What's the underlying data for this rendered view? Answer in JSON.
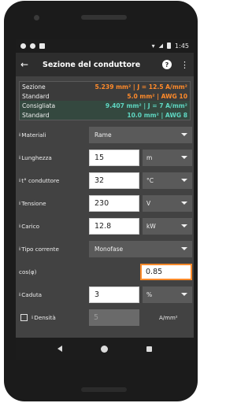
{
  "statusbar": {
    "time": "1:45"
  },
  "appbar": {
    "title": "Sezione del conduttore",
    "help_glyph": "?",
    "menu_glyph": "⋮",
    "back_glyph": "←"
  },
  "results": [
    {
      "label": "Sezione",
      "value": "5.239 mm² | J = 12.5 A/mm²",
      "color": "#ff8a2a"
    },
    {
      "label": "Standard",
      "value": "5.0 mm² | AWG 10",
      "color": "#ff8a2a"
    },
    {
      "label": "Consigliata",
      "value": "9.407 mm² | J = 7 A/mm²",
      "color": "#5fd7c2"
    },
    {
      "label": "Standard",
      "value": "10.0 mm² | AWG 8",
      "color": "#5fd7c2"
    }
  ],
  "form": {
    "materiali": {
      "label": "Materiali",
      "value": "Rame"
    },
    "lunghezza": {
      "label": "Lunghezza",
      "value": "15",
      "unit": "m"
    },
    "temperatura": {
      "label": "t° conduttore",
      "value": "32",
      "unit": "°C"
    },
    "tensione": {
      "label": "Tensione",
      "value": "230",
      "unit": "V"
    },
    "carico": {
      "label": "Carico",
      "value": "12.8",
      "unit": "kW"
    },
    "tipo_corrente": {
      "label": "Tipo corrente",
      "value": "Monofase"
    },
    "cos": {
      "label": "cos(φ)",
      "value": "0.85"
    },
    "caduta": {
      "label": "Caduta",
      "value": "3",
      "unit": "%"
    },
    "densita": {
      "label": "Densità",
      "value": "5",
      "unit": "A/mm²"
    }
  },
  "info_glyph": "ℹ"
}
